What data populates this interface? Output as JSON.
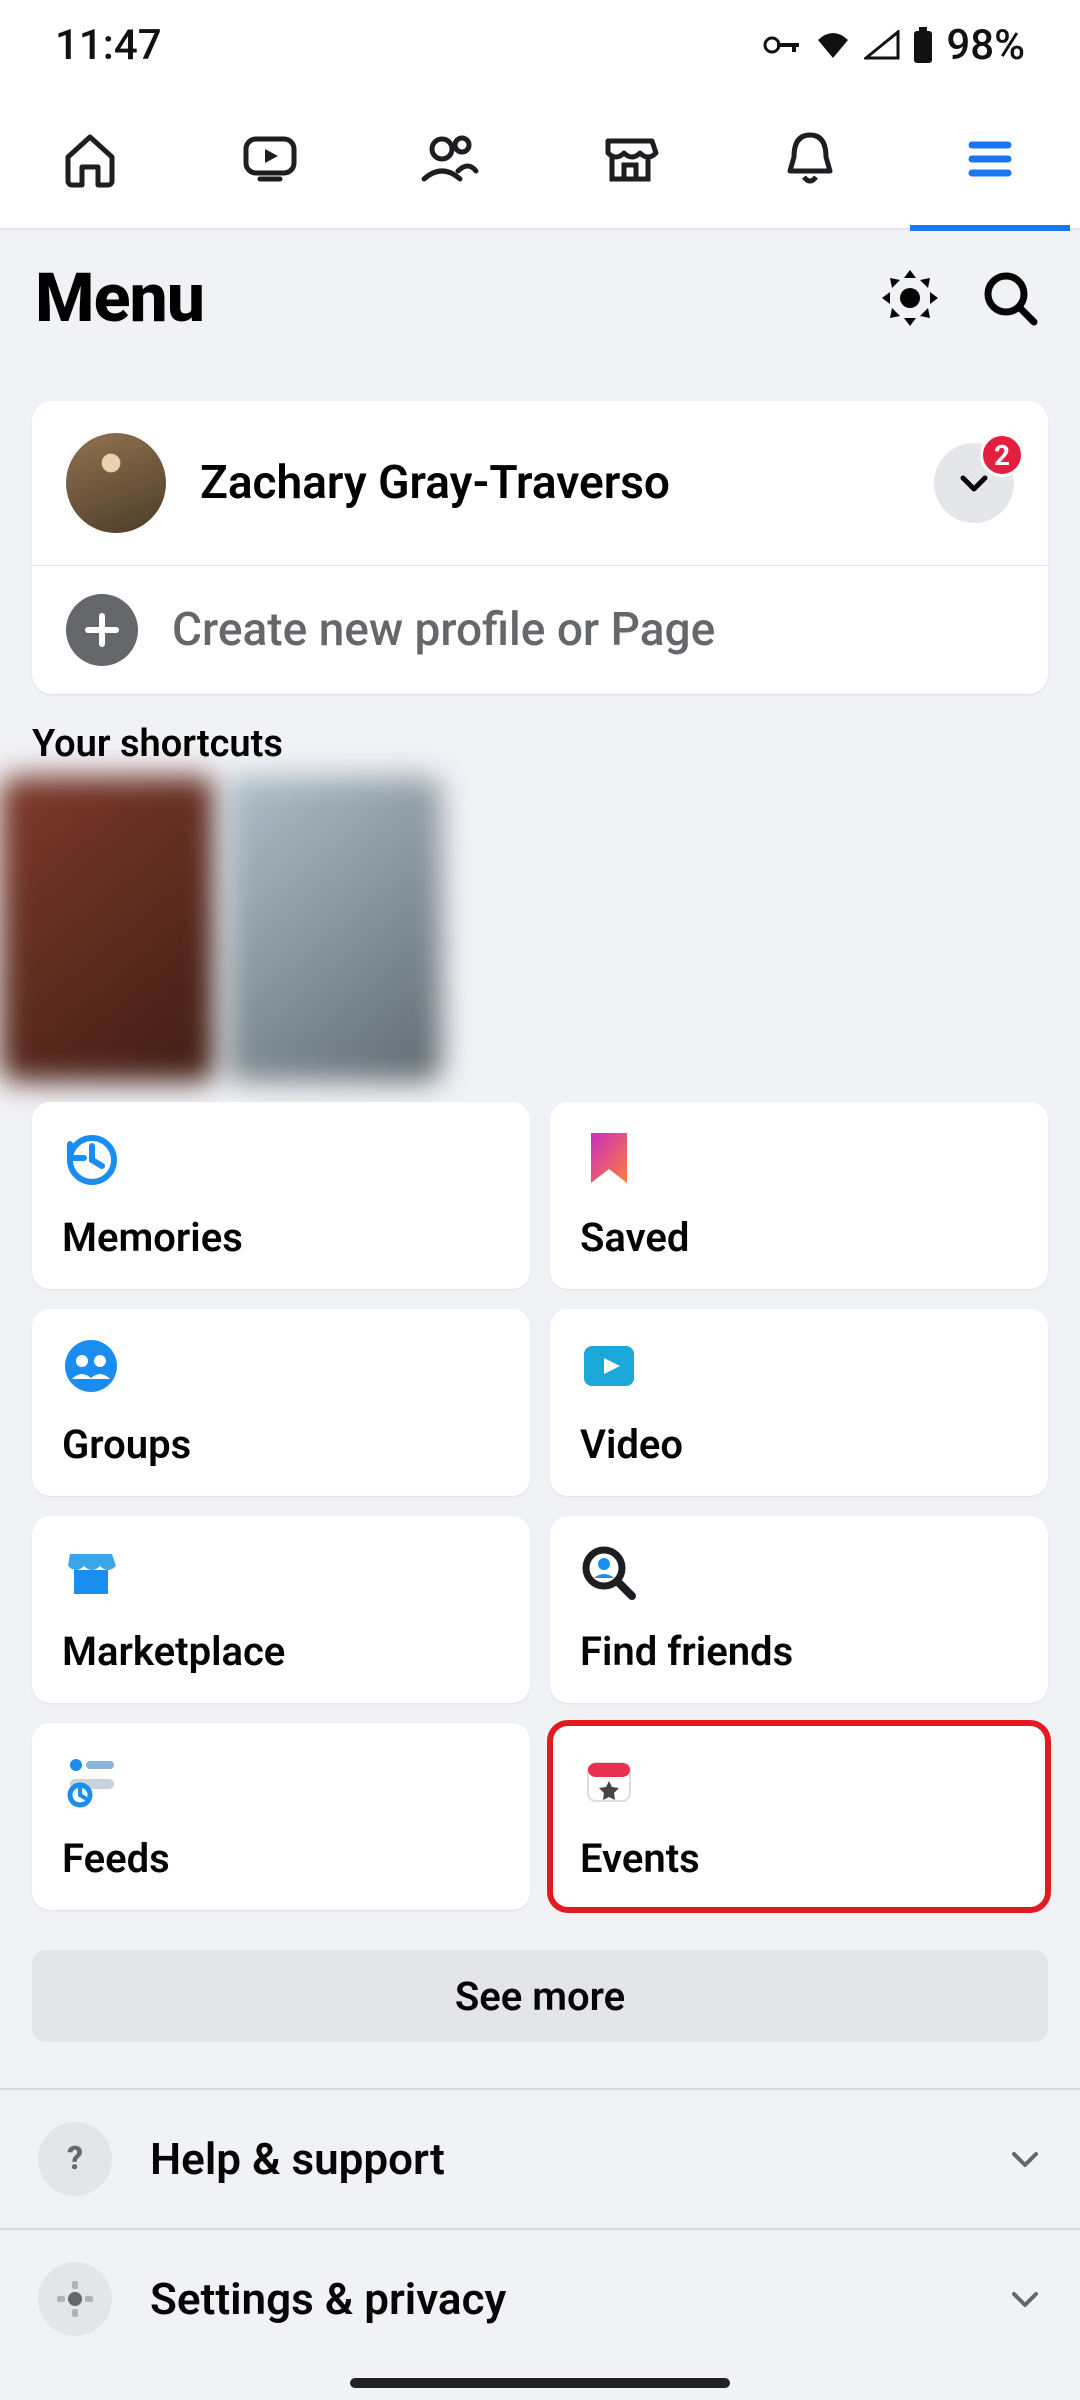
{
  "status": {
    "time": "11:47",
    "battery": "98%"
  },
  "nav": {
    "tabs": [
      "home",
      "watch",
      "friends",
      "marketplace",
      "notifications",
      "menu"
    ]
  },
  "header": {
    "title": "Menu"
  },
  "profile": {
    "name": "Zachary Gray-Traverso",
    "badge": "2",
    "create_label": "Create new profile or Page"
  },
  "shortcuts": {
    "heading": "Your shortcuts"
  },
  "grid": [
    {
      "icon": "memories-icon",
      "label": "Memories"
    },
    {
      "icon": "saved-icon",
      "label": "Saved"
    },
    {
      "icon": "groups-icon",
      "label": "Groups"
    },
    {
      "icon": "video-icon",
      "label": "Video"
    },
    {
      "icon": "marketplace-icon",
      "label": "Marketplace"
    },
    {
      "icon": "find-friends-icon",
      "label": "Find friends"
    },
    {
      "icon": "feeds-icon",
      "label": "Feeds"
    },
    {
      "icon": "events-icon",
      "label": "Events",
      "highlighted": true
    }
  ],
  "see_more": "See more",
  "footer": [
    {
      "icon": "help-icon",
      "label": "Help & support"
    },
    {
      "icon": "settings-icon",
      "label": "Settings & privacy"
    }
  ]
}
